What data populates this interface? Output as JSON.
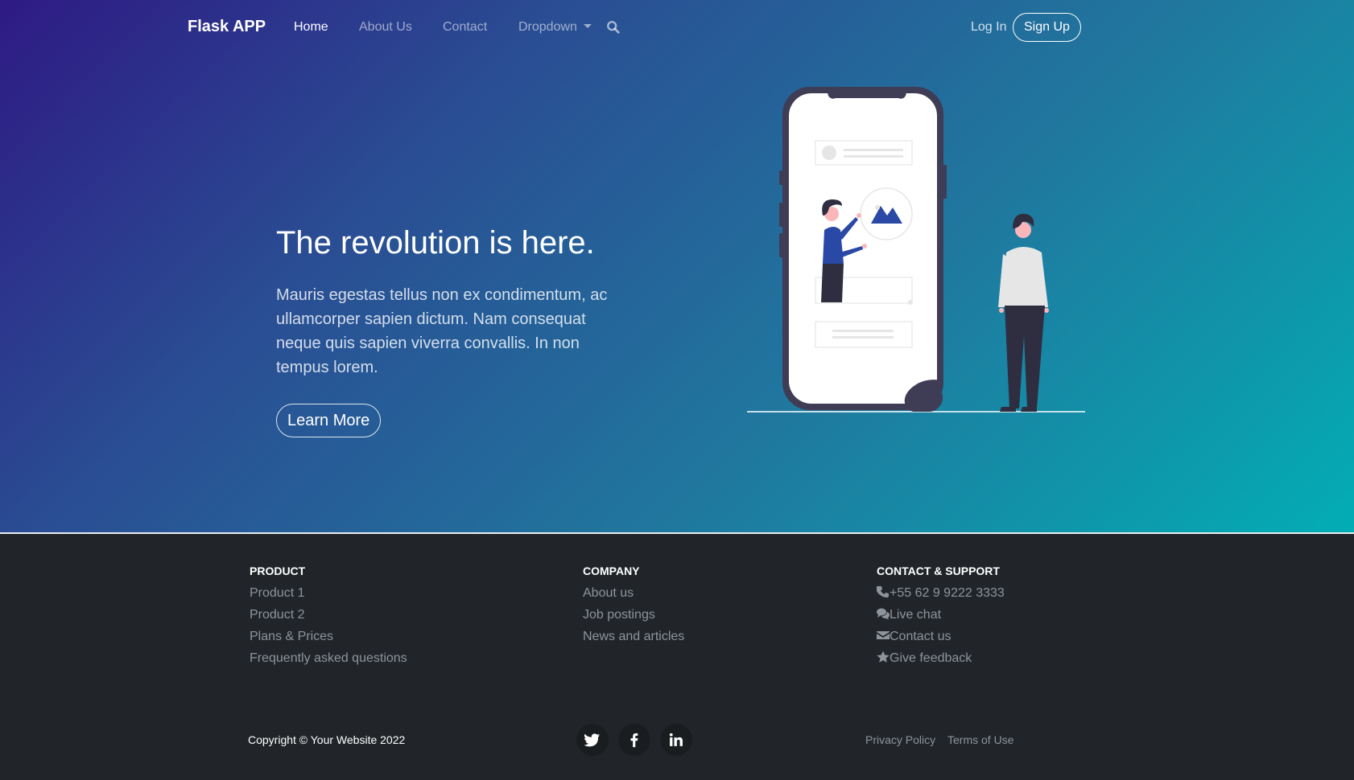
{
  "navbar": {
    "brand": "Flask APP",
    "links": [
      "Home",
      "About Us",
      "Contact",
      "Dropdown"
    ],
    "active": "Home",
    "search_icon": "search-icon",
    "login": "Log In",
    "signup": "Sign Up"
  },
  "hero": {
    "title": "The revolution is here.",
    "lead": "Mauris egestas tellus non ex condimentum, ac ullamcorper sapien dictum. Nam consequat neque quis sapien viverra convallis. In non tempus lorem.",
    "cta": "Learn More",
    "illustration": "person-with-phone-illustration"
  },
  "footer": {
    "product": {
      "heading": "PRODUCT",
      "links": [
        "Product 1",
        "Product 2",
        "Plans & Prices",
        "Frequently asked questions"
      ]
    },
    "company": {
      "heading": "COMPANY",
      "links": [
        "About us",
        "Job postings",
        "News and articles"
      ]
    },
    "support": {
      "heading": "CONTACT & SUPPORT",
      "links": [
        {
          "icon": "phone-icon",
          "label": "+55 62 9 9222 3333"
        },
        {
          "icon": "chat-icon",
          "label": "Live chat"
        },
        {
          "icon": "envelope-icon",
          "label": "Contact us"
        },
        {
          "icon": "star-icon",
          "label": "Give feedback"
        }
      ]
    },
    "copyright": "Copyright © Your Website 2022",
    "social": [
      "twitter-icon",
      "facebook-icon",
      "linkedin-icon"
    ],
    "legal": [
      "Privacy Policy",
      "Terms of Use"
    ]
  },
  "colors": {
    "gradient_start": "#2e1a84",
    "gradient_end": "#02adb5",
    "footer_bg": "#212529",
    "footer_link": "#8d949b",
    "illustration_accent": "#2a48a6"
  }
}
